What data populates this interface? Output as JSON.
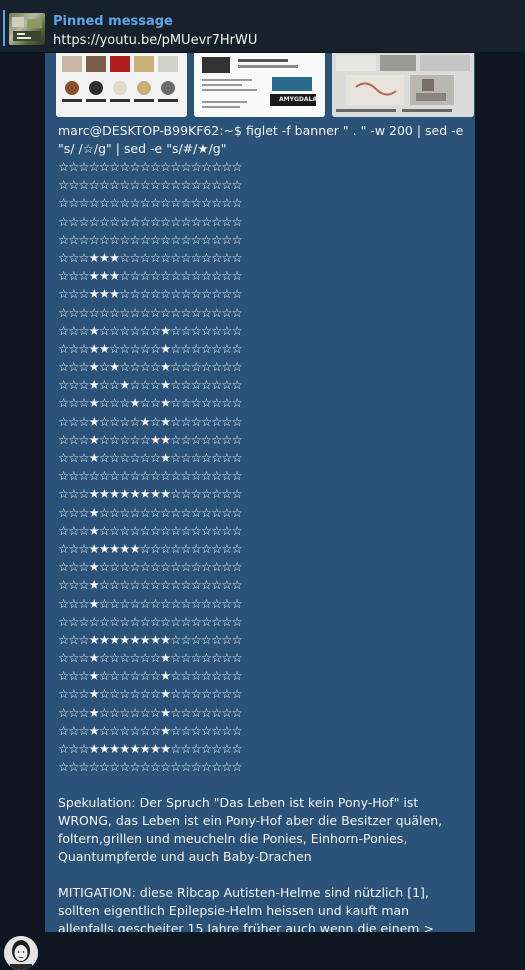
{
  "pinned": {
    "title": "Pinned message",
    "text": "https://youtu.be/pMUevr7HrWU"
  },
  "thumbnails": [
    {
      "label": "",
      "icon": "photo-grid-thumbnail"
    },
    {
      "label": "AMYGDALA",
      "icon": "document-thumbnail"
    },
    {
      "label": "",
      "icon": "photo-thumbnail"
    }
  ],
  "message": {
    "command": "marc@DESKTOP-B99KF62:~$ figlet -f banner \" . \" -w 200 | sed -e \"s/ /☆/g\" | sed -e \"s/#/★/g\"",
    "banner_rows": [
      "☆☆☆☆☆☆☆☆☆☆☆☆☆☆☆☆☆☆",
      "☆☆☆☆☆☆☆☆☆☆☆☆☆☆☆☆☆☆",
      "☆☆☆☆☆☆☆☆☆☆☆☆☆☆☆☆☆☆",
      "☆☆☆☆☆☆☆☆☆☆☆☆☆☆☆☆☆☆",
      "☆☆☆☆☆☆☆☆☆☆☆☆☆☆☆☆☆☆",
      "☆☆☆★★★☆☆☆☆☆☆☆☆☆☆☆☆",
      "☆☆☆★★★☆☆☆☆☆☆☆☆☆☆☆☆",
      "☆☆☆★★★☆☆☆☆☆☆☆☆☆☆☆☆",
      "☆☆☆☆☆☆☆☆☆☆☆☆☆☆☆☆☆☆",
      "☆☆☆★☆☆☆☆☆☆★☆☆☆☆☆☆☆",
      "☆☆☆★★☆☆☆☆☆★☆☆☆☆☆☆☆",
      "☆☆☆★☆★☆☆☆☆★☆☆☆☆☆☆☆",
      "☆☆☆★☆☆★☆☆☆★☆☆☆☆☆☆☆",
      "☆☆☆★☆☆☆★☆☆★☆☆☆☆☆☆☆",
      "☆☆☆★☆☆☆☆★☆★☆☆☆☆☆☆☆",
      "☆☆☆★☆☆☆☆☆★★☆☆☆☆☆☆☆",
      "☆☆☆★☆☆☆☆☆☆★☆☆☆☆☆☆☆",
      "☆☆☆☆☆☆☆☆☆☆☆☆☆☆☆☆☆☆",
      "☆☆☆★★★★★★★★☆☆☆☆☆☆☆",
      "☆☆☆★☆☆☆☆☆☆☆☆☆☆☆☆☆☆",
      "☆☆☆★☆☆☆☆☆☆☆☆☆☆☆☆☆☆",
      "☆☆☆★★★★★☆☆☆☆☆☆☆☆☆☆",
      "☆☆☆★☆☆☆☆☆☆☆☆☆☆☆☆☆☆",
      "☆☆☆★☆☆☆☆☆☆☆☆☆☆☆☆☆☆",
      "☆☆☆★☆☆☆☆☆☆☆☆☆☆☆☆☆☆",
      "☆☆☆☆☆☆☆☆☆☆☆☆☆☆☆☆☆☆",
      "☆☆☆★★★★★★★★☆☆☆☆☆☆☆",
      "☆☆☆★☆☆☆☆☆☆★☆☆☆☆☆☆☆",
      "☆☆☆★☆☆☆☆☆☆★☆☆☆☆☆☆☆",
      "☆☆☆★☆☆☆☆☆☆★☆☆☆☆☆☆☆",
      "☆☆☆★☆☆☆☆☆☆★☆☆☆☆☆☆☆",
      "☆☆☆★☆☆☆☆☆☆★☆☆☆☆☆☆☆",
      "☆☆☆★★★★★★★★☆☆☆☆☆☆☆",
      "☆☆☆☆☆☆☆☆☆☆☆☆☆☆☆☆☆☆"
    ],
    "paragraph1": "Spekulation: Der Spruch \"Das Leben ist kein Pony-Hof\" ist WRONG, das Leben ist ein Pony-Hof aber die Besitzer quälen, foltern,grillen und meucheln die Ponies, Einhorn-Ponies, Quantumpferde und auch Baby-Drachen",
    "paragraph2": "MITIGATION: diese Ribcap Autisten-Helme sind nützlich [1], sollten eigentlich Epilepsie-Helm heissen und kauft man allenfalls gescheiter 15 Jahre früher auch wenn die einem > >SCHIZOPHRENIE< < angehängt haben"
  },
  "colors": {
    "background": "#0e1621",
    "pinned_bar": "#17212b",
    "accent": "#5ea6e8",
    "bubble": "#2b5278"
  }
}
